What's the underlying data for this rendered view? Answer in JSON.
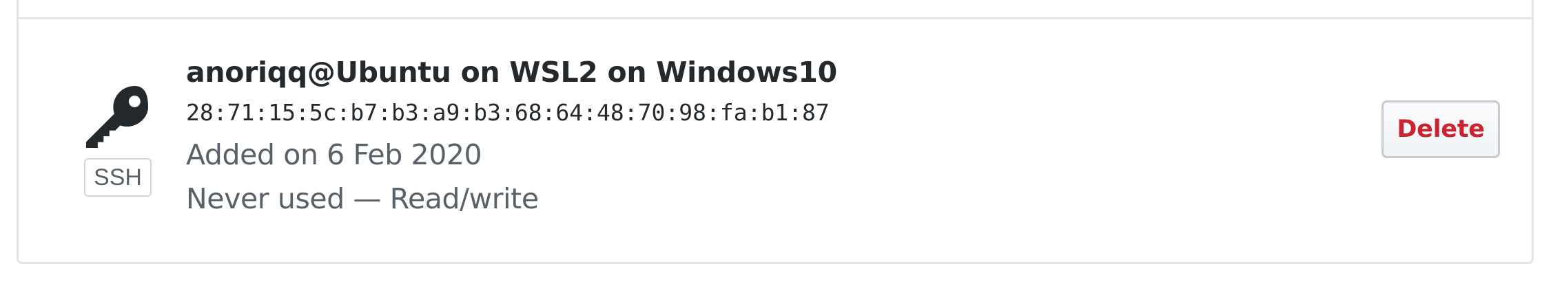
{
  "ssh_key": {
    "icon": "key-icon",
    "type_badge": "SSH",
    "title": "anoriqq@Ubuntu on WSL2 on Windows10",
    "fingerprint": "28:71:15:5c:b7:b3:a9:b3:68:64:48:70:98:fa:b1:87",
    "added": "Added on 6 Feb 2020",
    "usage": "Never used — Read/write"
  },
  "actions": {
    "delete_label": "Delete"
  },
  "colors": {
    "danger": "#cb2431",
    "text_primary": "#24292e",
    "text_muted": "#586069",
    "border": "#e1e4e8"
  }
}
